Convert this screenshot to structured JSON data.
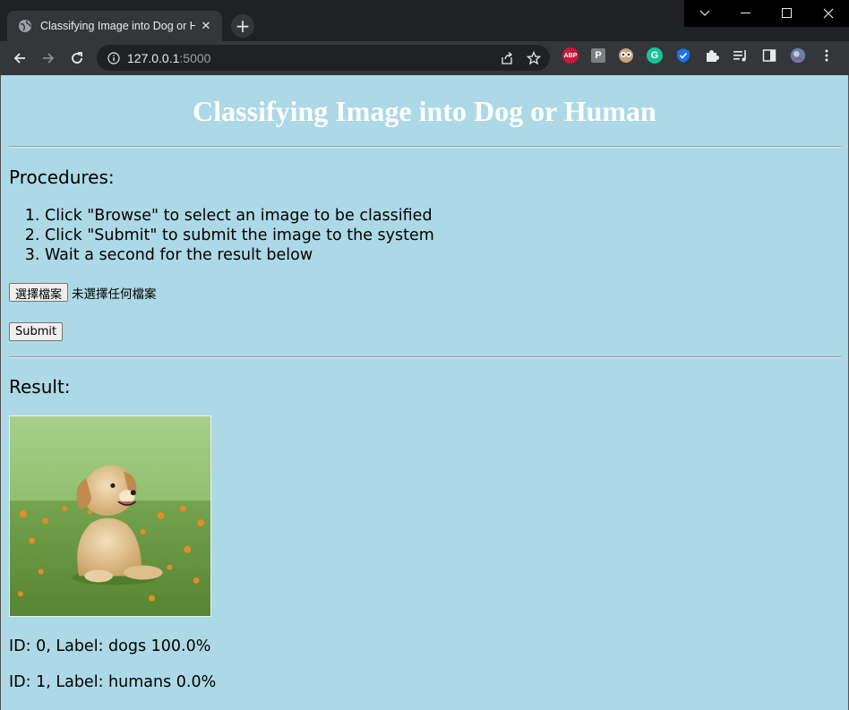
{
  "browser": {
    "tab_title": "Classifying Image into Dog or Human",
    "url_host": "127.0.0.1",
    "url_port": ":5000",
    "accent": "#35363a"
  },
  "page": {
    "heading": "Classifying Image into Dog or Human",
    "procedures_title": "Procedures:",
    "steps": [
      "Click \"Browse\" to select an image to be classified",
      "Click \"Submit\" to submit the image to the system",
      "Wait a second for the result below"
    ],
    "file_button_label": "選擇檔案",
    "file_status": "未選擇任何檔案",
    "submit_label": "Submit",
    "result_title": "Result:",
    "predictions": [
      "ID: 0, Label: dogs 100.0%",
      "ID: 1, Label: humans 0.0%"
    ],
    "background": "#add8e6"
  }
}
